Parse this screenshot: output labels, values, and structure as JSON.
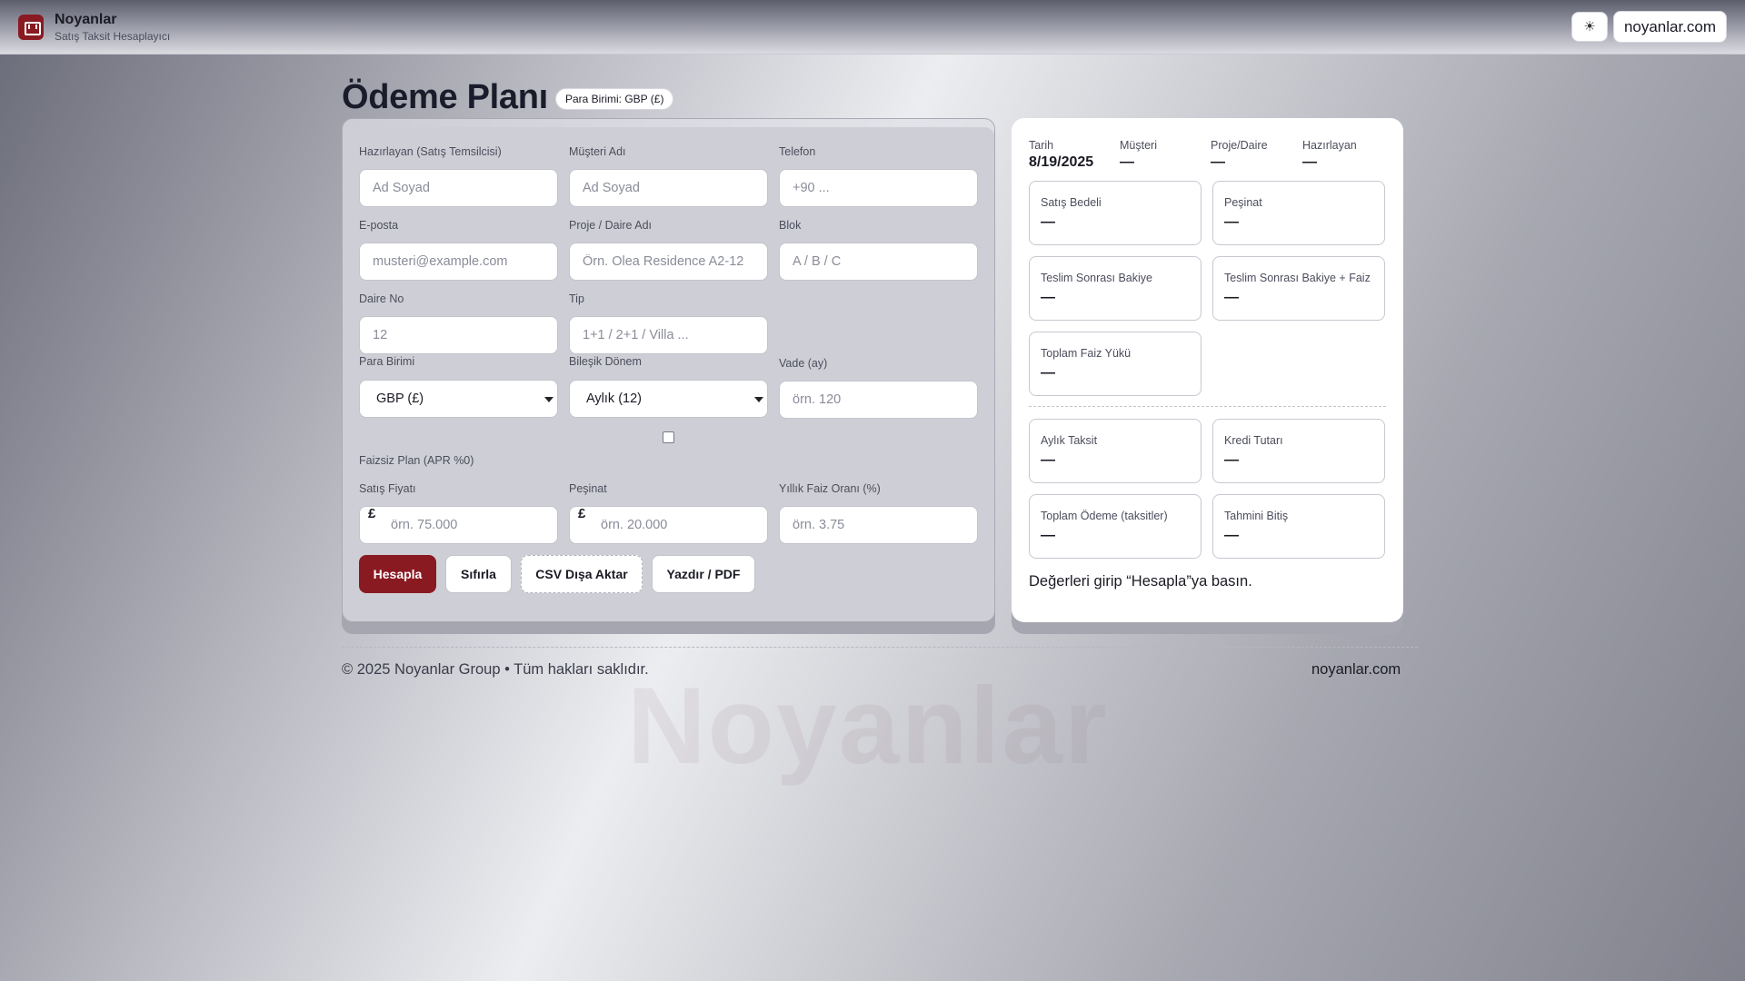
{
  "header": {
    "brand": "Noyanlar",
    "subtitle": "Satış Taksit Hesaplayıcı",
    "theme_icon": "sun-icon",
    "theme_glyph": "☀",
    "site_link": "noyanlar.com"
  },
  "page": {
    "title": "Ödeme Planı",
    "currency_badge": "Para Birimi: GBP (£)"
  },
  "form": {
    "preparer": {
      "label": "Hazırlayan (Satış Temsilcisi)",
      "placeholder": "Ad Soyad"
    },
    "customer": {
      "label": "Müşteri Adı",
      "placeholder": "Ad Soyad"
    },
    "phone": {
      "label": "Telefon",
      "placeholder": "+90 ..."
    },
    "email": {
      "label": "E-posta",
      "placeholder": "musteri@example.com"
    },
    "project": {
      "label": "Proje / Daire Adı",
      "placeholder": "Örn. Olea Residence A2-12"
    },
    "block": {
      "label": "Blok",
      "placeholder": "A / B / C"
    },
    "unit_no": {
      "label": "Daire No",
      "placeholder": "12"
    },
    "type": {
      "label": "Tip",
      "placeholder": "1+1 / 2+1 / Villa ..."
    },
    "currency": {
      "label": "Para Birimi",
      "value": "GBP (£)"
    },
    "compound": {
      "label": "Bileşik Dönem",
      "value": "Aylık (12)"
    },
    "term": {
      "label": "Vade (ay)",
      "placeholder": "örn. 120"
    },
    "interest_free": {
      "label": "Faizsiz Plan (APR %0)",
      "checked": false
    },
    "price": {
      "label": "Satış Fiyatı",
      "prefix": "£",
      "placeholder": "örn. 75.000"
    },
    "down_payment": {
      "label": "Peşinat",
      "prefix": "£",
      "placeholder": "örn. 20.000"
    },
    "rate": {
      "label": "Yıllık Faiz Oranı (%)",
      "placeholder": "örn. 3.75"
    },
    "buttons": {
      "calculate": "Hesapla",
      "reset": "Sıfırla",
      "csv": "CSV Dışa Aktar",
      "print": "Yazdır / PDF"
    }
  },
  "summary": {
    "meta": {
      "date": {
        "label": "Tarih",
        "value": "8/19/2025"
      },
      "customer": {
        "label": "Müşteri",
        "value": "—"
      },
      "project": {
        "label": "Proje/Daire",
        "value": "—"
      },
      "preparer": {
        "label": "Hazırlayan",
        "value": "—"
      }
    },
    "stats": [
      {
        "label": "Satış Bedeli",
        "value": "—"
      },
      {
        "label": "Peşinat",
        "value": "—"
      },
      {
        "label": "Teslim Sonrası Bakiye",
        "value": "—"
      },
      {
        "label": "Teslim Sonrası Bakiye + Faiz",
        "value": "—"
      },
      {
        "label": "Toplam Faiz Yükü",
        "value": "—"
      }
    ],
    "results": [
      {
        "label": "Aylık Taksit",
        "value": "—"
      },
      {
        "label": "Kredi Tutarı",
        "value": "—"
      },
      {
        "label": "Toplam Ödeme (taksitler)",
        "value": "—"
      },
      {
        "label": "Tahmini Bitiş",
        "value": "—"
      }
    ],
    "hint": "Değerleri girip “Hesapla”ya basın."
  },
  "footer": {
    "copyright": "© 2025 Noyanlar Group • Tüm hakları saklıdır.",
    "site": "noyanlar.com",
    "watermark": "Noyanlar"
  }
}
